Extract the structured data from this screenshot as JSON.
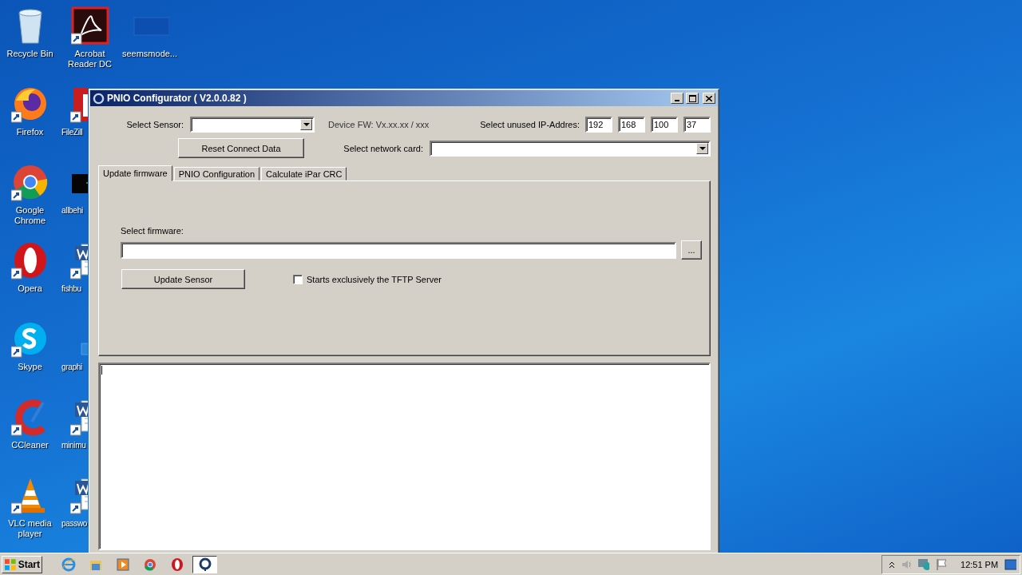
{
  "desktop": {
    "columns": [
      {
        "icons": [
          {
            "label": "Recycle Bin",
            "kind": "recycle"
          },
          {
            "label": "Firefox",
            "kind": "firefox"
          },
          {
            "label": "Google Chrome",
            "kind": "chrome"
          },
          {
            "label": "Opera",
            "kind": "opera"
          },
          {
            "label": "Skype",
            "kind": "skype"
          },
          {
            "label": "CCleaner",
            "kind": "ccleaner"
          },
          {
            "label": "VLC media player",
            "kind": "vlc"
          }
        ]
      },
      {
        "icons": [
          {
            "label": "Acrobat Reader DC",
            "kind": "acrobat"
          },
          {
            "label": "FileZill",
            "kind": "filezilla"
          },
          {
            "label": "allbehi",
            "kind": "dark"
          },
          {
            "label": "fishbu",
            "kind": "word"
          },
          {
            "label": "graphi",
            "kind": "blank"
          },
          {
            "label": "minimu",
            "kind": "word"
          },
          {
            "label": "passwo",
            "kind": "word"
          }
        ]
      },
      {
        "icons": [
          {
            "label": "seemsmode...",
            "kind": "bluefile"
          }
        ]
      }
    ]
  },
  "window": {
    "title": "PNIO Configurator ( V2.0.0.82 )"
  },
  "header": {
    "sensor_label": "Select Sensor:",
    "device_fw": "Device FW: Vx.xx.xx / xxx",
    "ip_label": "Select unused IP-Addres:",
    "ip_parts": [
      "192",
      "168",
      "100",
      "37"
    ],
    "reset_button": "Reset Connect Data",
    "network_label": "Select network card:"
  },
  "tabs": [
    {
      "label": "Update firmware",
      "selected": true
    },
    {
      "label": "PNIO Configuration",
      "selected": false
    },
    {
      "label": "Calculate iPar CRC",
      "selected": false
    }
  ],
  "firmware": {
    "label": "Select firmware:",
    "browse_button": "...",
    "update_button": "Update Sensor",
    "tftp": {
      "label": "Starts exclusively the TFTP Server",
      "checked": false
    }
  },
  "taskbar": {
    "start": "Start",
    "items": [
      {
        "kind": "ie",
        "selected": false
      },
      {
        "kind": "folder",
        "selected": false
      },
      {
        "kind": "media",
        "selected": false
      },
      {
        "kind": "chrome",
        "selected": false
      },
      {
        "kind": "opera",
        "selected": false
      },
      {
        "kind": "pnio",
        "selected": true
      }
    ],
    "time": "12:51 PM"
  }
}
